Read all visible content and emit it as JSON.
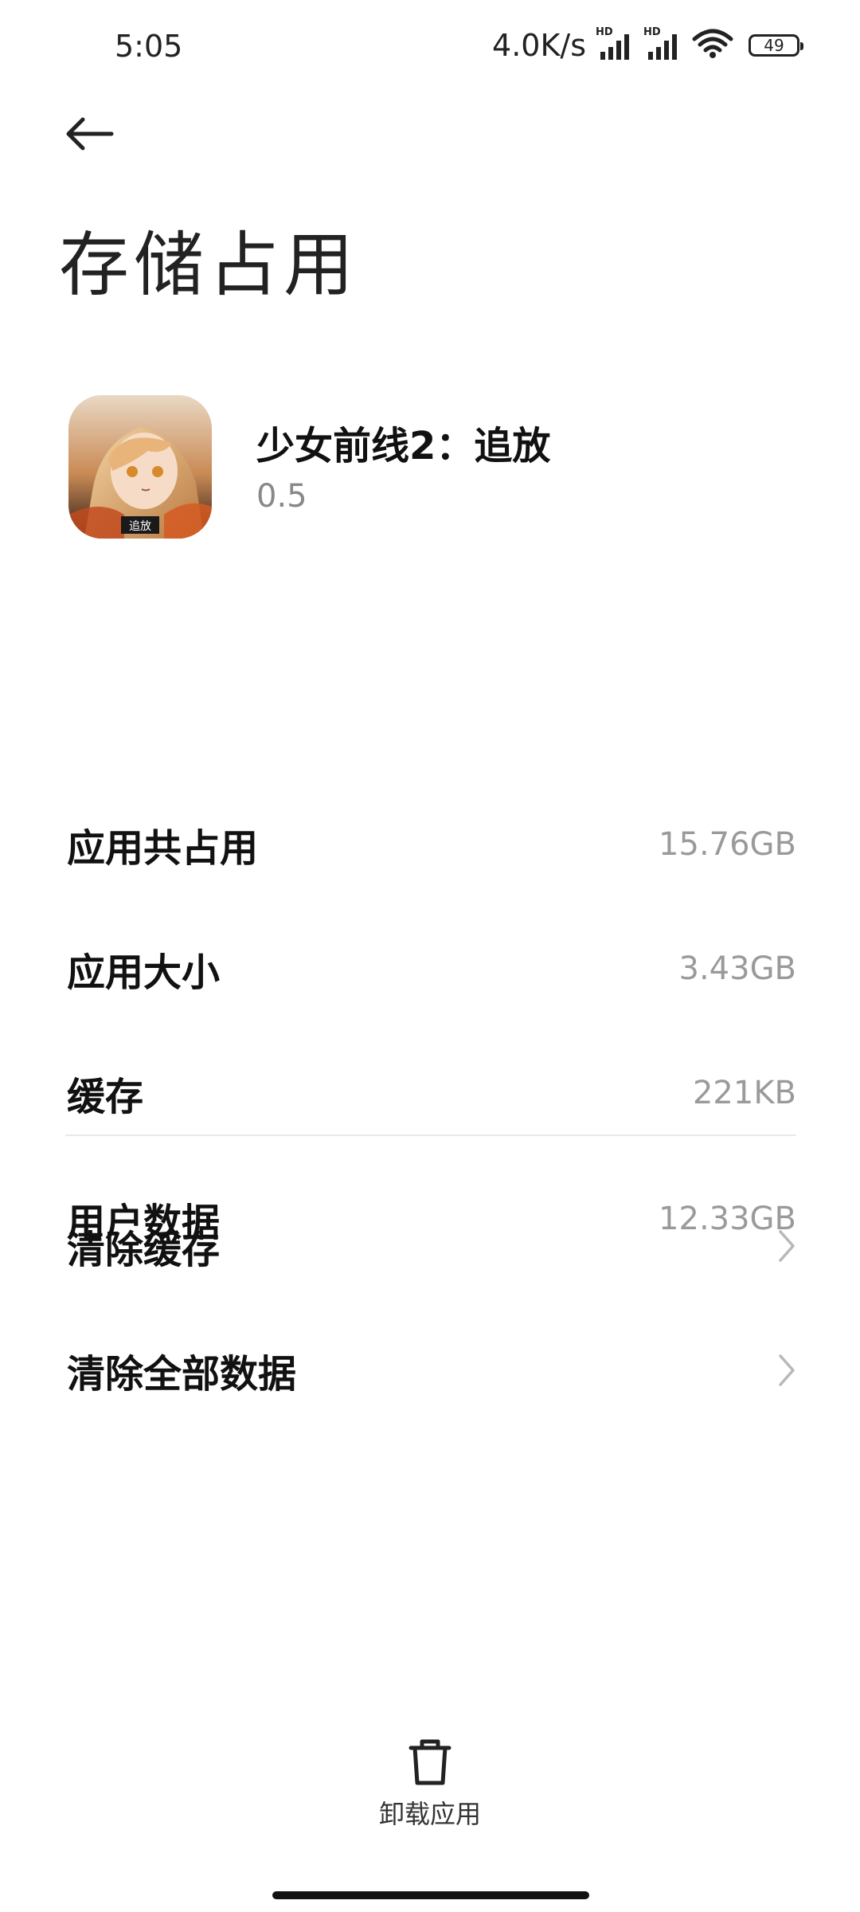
{
  "status_bar": {
    "time": "5:05",
    "net_speed": "4.0K/s",
    "sim1_badge": "HD",
    "sim2_badge": "HD",
    "battery": "49"
  },
  "header": {
    "title": "存储占用"
  },
  "app": {
    "name": "少女前线2：追放",
    "version": "0.5",
    "icon_text": "追放"
  },
  "storage": {
    "total_label": "应用共占用",
    "total_value": "15.76GB",
    "app_size_label": "应用大小",
    "app_size_value": "3.43GB",
    "cache_label": "缓存",
    "cache_value": "221KB",
    "user_data_label": "用户数据",
    "user_data_value": "12.33GB"
  },
  "actions": {
    "clear_cache": "清除缓存",
    "clear_all_data": "清除全部数据"
  },
  "bottom": {
    "uninstall_label": "卸载应用"
  },
  "icons": {
    "back": "arrow-left-icon",
    "chevron": "chevron-right-icon",
    "trash": "trash-icon",
    "wifi": "wifi-icon",
    "signal": "signal-icon",
    "battery": "battery-icon"
  }
}
